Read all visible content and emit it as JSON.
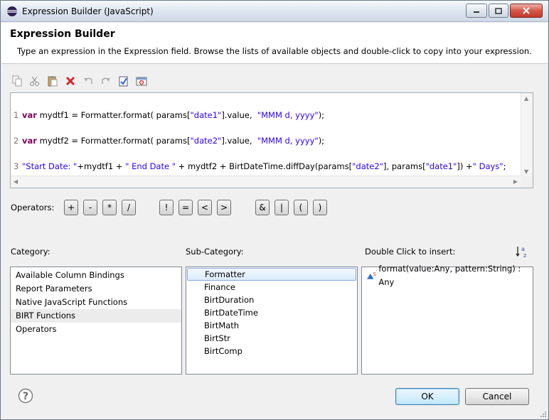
{
  "window": {
    "title": "Expression Builder (JavaScript)"
  },
  "header": {
    "title": "Expression Builder",
    "description": "Type an expression in the Expression field. Browse the lists of available objects and double-click to copy into your expression."
  },
  "toolbar": {
    "icons": [
      "copy-icon",
      "cut-icon",
      "paste-icon",
      "delete-icon",
      "undo-icon",
      "redo-icon",
      "validate-icon",
      "calculate-icon"
    ]
  },
  "editor": {
    "lines": [
      {
        "num": "1",
        "kw": "var",
        "a": " mydtf1 = Formatter.format( params[",
        "s1": "\"date1\"",
        "b": "].value,  ",
        "s2": "\"MMM d, yyyy\"",
        "c": ");"
      },
      {
        "num": "2",
        "kw": "var",
        "a": " mydtf2 = Formatter.format( params[",
        "s1": "\"date2\"",
        "b": "].value,  ",
        "s2": "\"MMM d, yyyy\"",
        "c": ");"
      },
      {
        "num": "3",
        "s1": "\"Start Date: \"",
        "a": "+mydtf1 + ",
        "s2": "\" End Date \"",
        "b": " + mydtf2 + BirtDateTime.diffDay(params[",
        "s3": "\"date2\"",
        "c": "], params[",
        "s4": "\"date1\"",
        "d": "]) +",
        "s5": "\" Days\"",
        "e": ";"
      }
    ]
  },
  "operators": {
    "label": "Operators:",
    "buttons": [
      "+",
      "-",
      "*",
      "/",
      "!",
      "=",
      "<",
      ">",
      "&",
      "|",
      "(",
      ")"
    ]
  },
  "category": {
    "label": "Category:",
    "items": [
      "Available Column Bindings",
      "Report Parameters",
      "Native JavaScript Functions",
      "BIRT Functions",
      "Operators"
    ],
    "selected": "BIRT Functions"
  },
  "subcategory": {
    "label": "Sub-Category:",
    "items": [
      "Formatter",
      "Finance",
      "BirtDuration",
      "BirtDateTime",
      "BirtMath",
      "BirtStr",
      "BirtComp"
    ],
    "selected": "Formatter"
  },
  "insert": {
    "label": "Double Click to insert:",
    "items": [
      "format(value:Any, pattern:String) : Any"
    ]
  },
  "buttons": {
    "ok": "OK",
    "cancel": "Cancel"
  }
}
